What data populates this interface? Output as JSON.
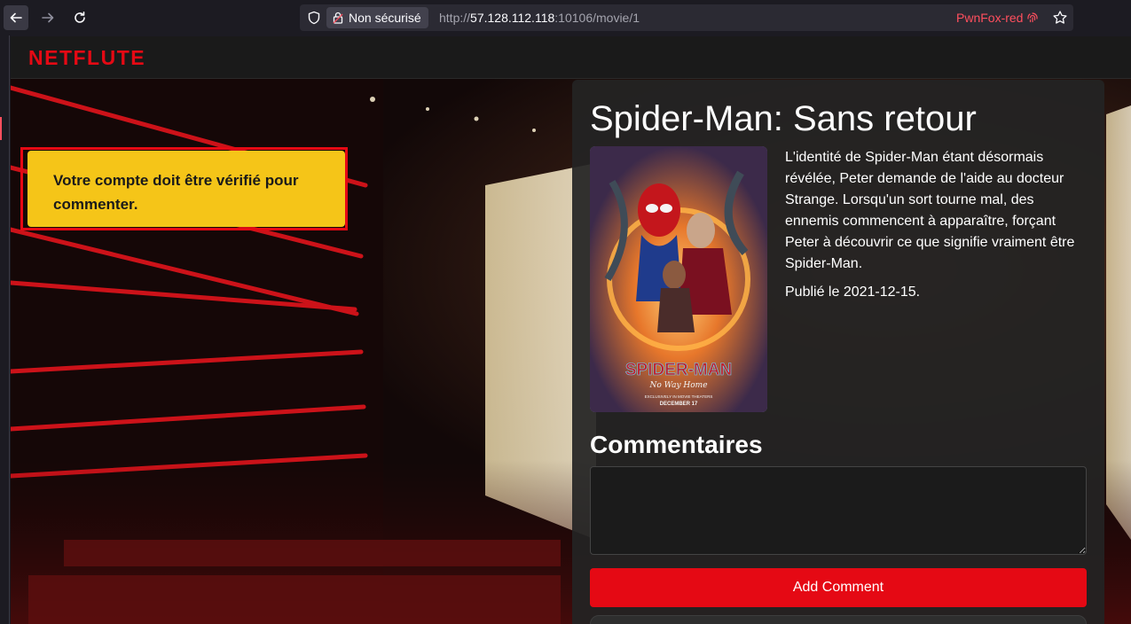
{
  "browser": {
    "security_label": "Non sécurisé",
    "url_scheme": "http://",
    "url_host": "57.128.112.118",
    "url_rest": ":10106/movie/1",
    "container_name": "PwnFox-red",
    "container_color": "#ff4f5e"
  },
  "site": {
    "logo": "NETFLUTE",
    "brand_color": "#e50914"
  },
  "alert": {
    "message": "Votre compte doit être vérifié pour commenter.",
    "color": "#f5c518"
  },
  "movie": {
    "title": "Spider-Man: Sans retour",
    "synopsis": "L'identité de Spider-Man étant désormais révélée, Peter demande de l'aide au docteur Strange. Lorsqu'un sort tourne mal, des ennemis commencent à apparaître, forçant Peter à découvrir ce que signifie vraiment être Spider-Man.",
    "published": "Publié le 2021-12-15.",
    "poster": {
      "title": "SPIDER-MAN",
      "subtitle": "No Way Home",
      "tagline": "EXCLUSIVELY IN MOVIE THEATERS",
      "date": "DECEMBER 17"
    }
  },
  "comments": {
    "heading": "Commentaires",
    "input_value": "",
    "submit_label": "Add Comment"
  }
}
